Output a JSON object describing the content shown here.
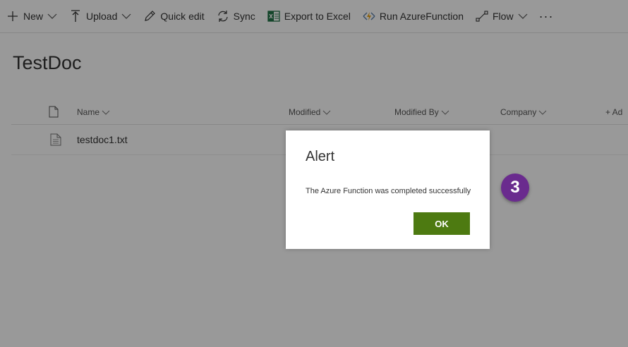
{
  "commandbar": {
    "new_label": "New",
    "upload_label": "Upload",
    "quickedit_label": "Quick edit",
    "sync_label": "Sync",
    "export_label": "Export to Excel",
    "azure_label": "Run AzureFunction",
    "flow_label": "Flow",
    "more_label": "···"
  },
  "library": {
    "title": "TestDoc",
    "columns": {
      "name": "Name",
      "modified": "Modified",
      "modified_by": "Modified By",
      "company": "Company",
      "add_column": "+ Ad"
    },
    "rows": [
      {
        "name": "testdoc1.txt"
      }
    ]
  },
  "dialog": {
    "title": "Alert",
    "message": "The Azure Function was completed successfully",
    "ok_label": "OK"
  },
  "annotation": {
    "step_number": "3"
  },
  "colors": {
    "ok_button": "#4d7a11",
    "badge": "#6a2b8e",
    "excel_icon": "#217346"
  }
}
